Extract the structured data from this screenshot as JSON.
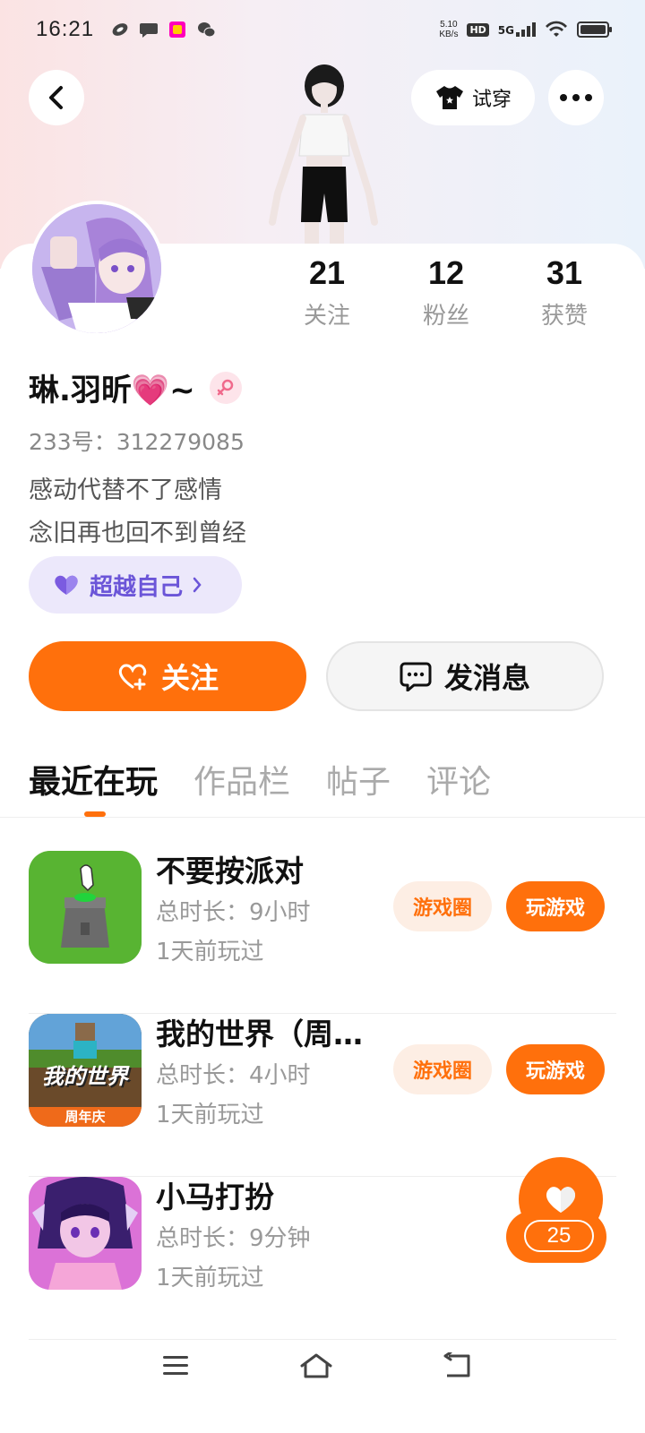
{
  "status_bar": {
    "time": "16:21",
    "net_speed_value": "5.10",
    "net_speed_unit": "KB/s",
    "hd": "HD",
    "signal": "5G",
    "battery_level": 0.85
  },
  "header": {
    "tryon_label": "试穿",
    "icons": [
      "back-arrow-icon",
      "shirt-icon",
      "more-icon"
    ]
  },
  "profile": {
    "username": "琳.羽昕💗~",
    "gender": "female",
    "uid_label": "233号：",
    "uid": "312279085",
    "bio_line1": "感动代替不了感情",
    "bio_line2": "念旧再也回不到曾经",
    "tag": "超越自己"
  },
  "stats": [
    {
      "value": "21",
      "label": "关注"
    },
    {
      "value": "12",
      "label": "粉丝"
    },
    {
      "value": "31",
      "label": "获赞"
    }
  ],
  "actions": {
    "follow_label": "关注",
    "message_label": "发消息"
  },
  "tabs": [
    {
      "label": "最近在玩",
      "active": true
    },
    {
      "label": "作品栏",
      "active": false
    },
    {
      "label": "帖子",
      "active": false
    },
    {
      "label": "评论",
      "active": false
    }
  ],
  "games": [
    {
      "title": "不要按派对",
      "duration": "总时长：9小时",
      "last_played": "1天前玩过",
      "circle_label": "游戏圈",
      "play_label": "玩游戏"
    },
    {
      "title": "我的世界（周…",
      "duration": "总时长：4小时",
      "last_played": "1天前玩过",
      "circle_label": "游戏圈",
      "play_label": "玩游戏"
    },
    {
      "title": "小马打扮",
      "duration": "总时长：9分钟",
      "last_played": "1天前玩过"
    }
  ],
  "game_icons": {
    "minecraft_title": "我的世界",
    "minecraft_banner": "周年庆"
  },
  "like_float": {
    "count": "25"
  },
  "colors": {
    "accent": "#ff700c",
    "accent_soft": "#fdeee4",
    "tag_bg": "#ece8fb",
    "tag_text": "#6b55d8"
  }
}
